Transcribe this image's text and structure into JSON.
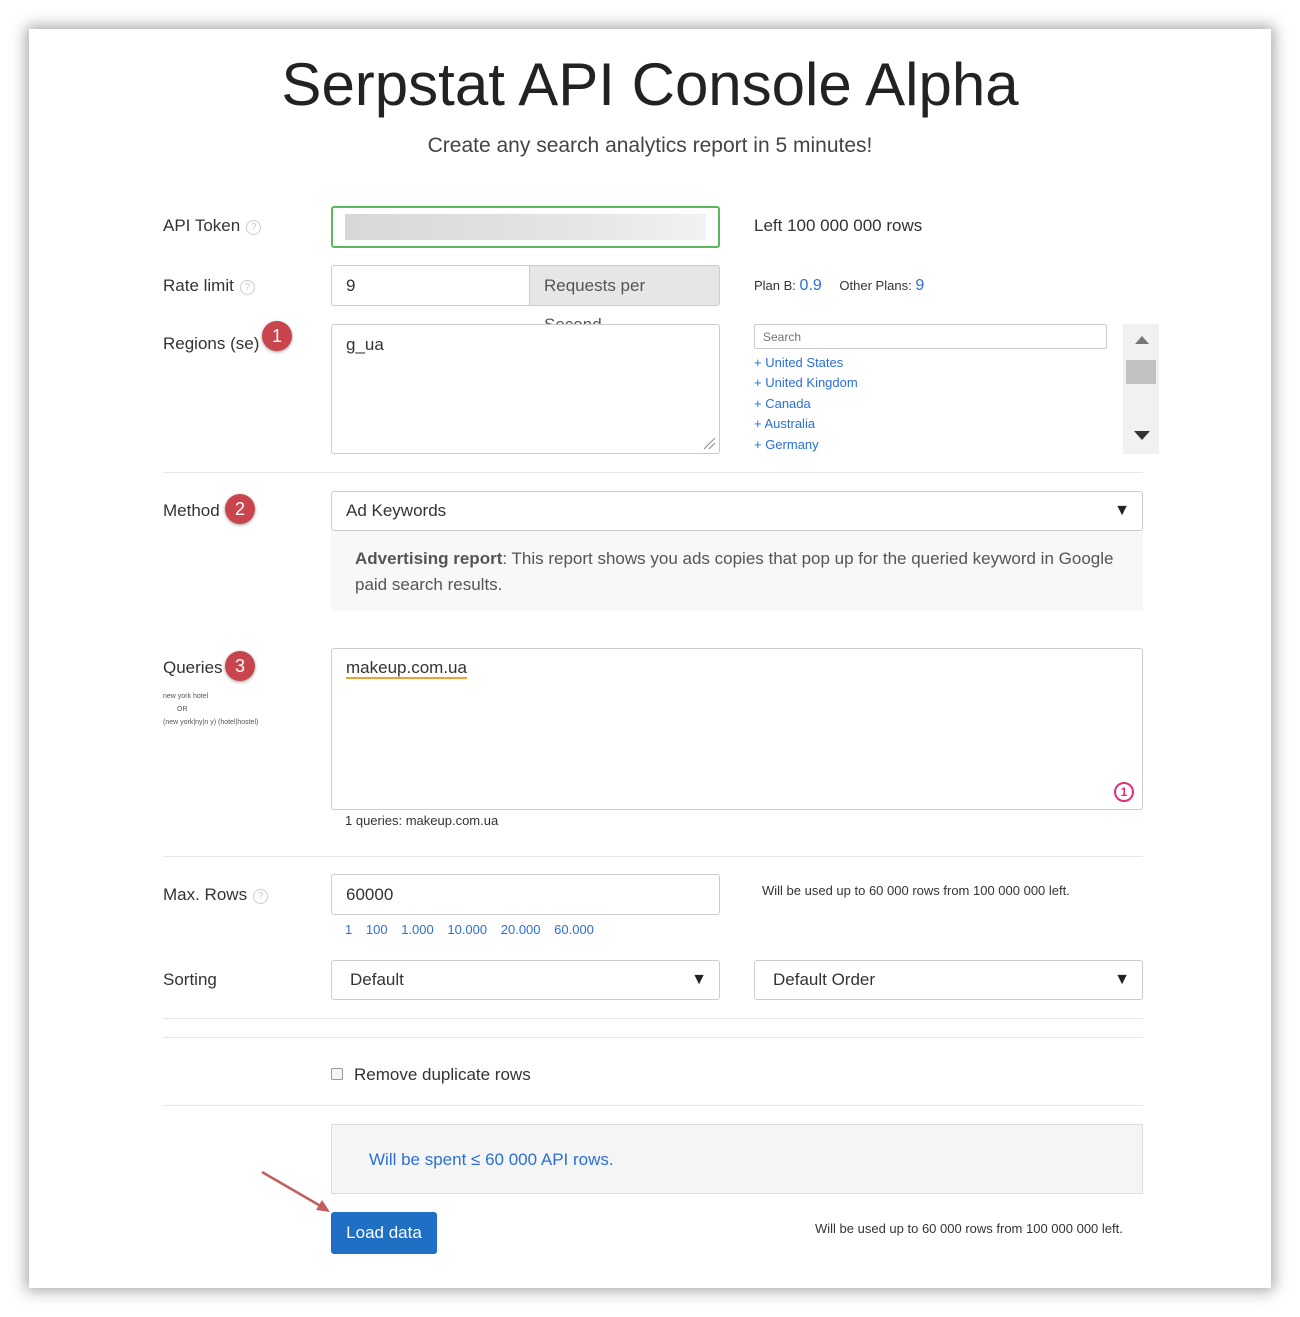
{
  "header": {
    "title": "Serpstat API Console Alpha",
    "subtitle": "Create any search analytics report in 5 minutes!"
  },
  "api_token": {
    "label": "API Token",
    "value": "",
    "rows_left": "Left 100 000 000 rows"
  },
  "rate_limit": {
    "label": "Rate limit",
    "value": "9",
    "unit": "Requests per Second",
    "plan_b_label": "Plan B:",
    "plan_b_value": "0.9",
    "other_plans_label": "Other Plans:",
    "other_plans_value": "9"
  },
  "regions": {
    "label": "Regions (se)",
    "badge": "1",
    "value": "g_ua",
    "search_placeholder": "Search",
    "items": [
      "+ United States",
      "+ United Kingdom",
      "+ Canada",
      "+ Australia",
      "+ Germany"
    ]
  },
  "method": {
    "label": "Method",
    "badge": "2",
    "selected": "Ad Keywords",
    "description_bold": "Advertising report",
    "description": ": This report shows you ads copies that pop up for the queried keyword in Google paid search results."
  },
  "queries": {
    "label": "Queries",
    "badge": "3",
    "hint_line1": "new york hotel",
    "hint_line2": "OR",
    "hint_line3": "(new york|ny|n y) (hotel|hostel)",
    "value": "makeup.com.ua",
    "count_badge": "1",
    "summary": "1 queries: makeup.com.ua"
  },
  "max_rows": {
    "label": "Max. Rows",
    "value": "60000",
    "quick_links": [
      "1",
      "100",
      "1.000",
      "10.000",
      "20.000",
      "60.000"
    ],
    "note": "Will be used up to 60 000 rows from 100 000 000 left."
  },
  "sorting": {
    "label": "Sorting",
    "field": "Default",
    "order": "Default Order"
  },
  "options": {
    "remove_duplicates": "Remove duplicate rows"
  },
  "summary": {
    "spent": "Will be spent ≤ 60 000 API rows.",
    "load_button": "Load data",
    "footer_note": "Will be used up to 60 000 rows from 100 000 000 left."
  },
  "colors": {
    "accent": "#2a6fd6",
    "badge": "#c9454d",
    "button": "#1f6fc5",
    "token_border": "#5cb85c"
  }
}
